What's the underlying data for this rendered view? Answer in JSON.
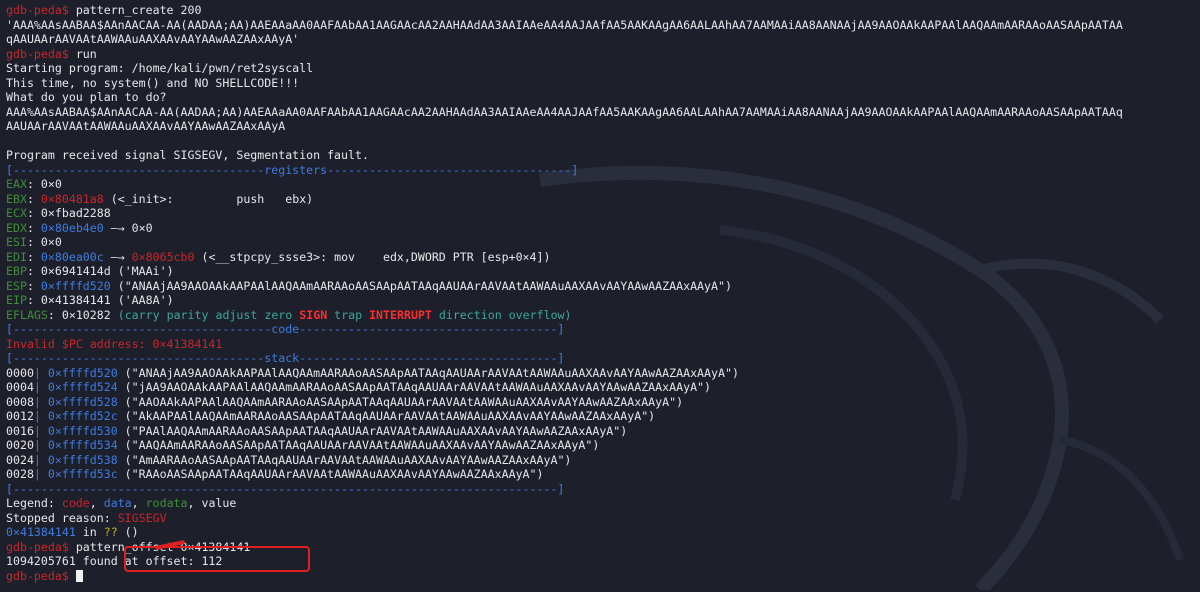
{
  "prompt": "gdb-peda$",
  "cmd_pattern_create": "pattern_create 200",
  "pattern_quoted_1": "'AAA%AAsAABAA$AAnAACAA-AA(AADAA;AA)AAEAAaAA0AAFAAbAA1AAGAAcAA2AAHAAdAA3AAIAAeAA4AAJAAfAA5AAKAAgAA6AALAAhAA7AAMAAiAA8AANAAjAA9AAOAAkAAPAAlAAQAAmAARAAoAASAApAATAA",
  "pattern_quoted_2": "qAAUAArAAVAAtAAWAAuAAXAAvAAYAAwAAZAAxAAyA'",
  "cmd_run": "run",
  "starting": "Starting program: /home/kali/pwn/ret2syscall",
  "msg1": "This time, no system() and NO SHELLCODE!!!",
  "msg2": "What do you plan to do?",
  "input_1": "AAA%AAsAABAA$AAnAACAA-AA(AADAA;AA)AAEAAaAA0AAFAAbAA1AAGAAcAA2AAHAAdAA3AAIAAeAA4AAJAAfAA5AAKAAgAA6AALAAhAA7AAMAAiAA8AANAAjAA9AAOAAkAAPAAlAAQAAmAARAAoAASAApAATAAq",
  "input_2": "AAUAArAAVAAtAAWAAuAAXAAvAAYAAwAAZAAxAAyA",
  "signal": "Program received signal SIGSEGV, Segmentation fault.",
  "divider_registers": "[------------------------------------registers-----------------------------------]",
  "divider_code": "[-------------------------------------code-------------------------------------]",
  "divider_stack": "[------------------------------------stack-------------------------------------]",
  "divider_end": "[------------------------------------------------------------------------------]",
  "registers": {
    "eax": {
      "name": "EAX",
      "value": "0×0",
      "rest": ""
    },
    "ebx": {
      "name": "EBX",
      "value": "0×80481a8",
      "rest": " (<_init>:         push   ebx)"
    },
    "ecx": {
      "name": "ECX",
      "value": "0×fbad2288",
      "rest": ""
    },
    "edx": {
      "name": "EDX",
      "value": "0×80eb4e0",
      "rest": " —→ 0×0"
    },
    "esi": {
      "name": "ESI",
      "value": "0×0",
      "rest": ""
    },
    "edi_name": "EDI",
    "edi_v1": "0×80ea00c",
    "edi_arrow": " —→ ",
    "edi_v2": "0×8065cb0",
    "edi_rest": " (<__stpcpy_ssse3>: mov    edx,DWORD PTR [esp+0×4])",
    "ebp": {
      "name": "EBP",
      "value": "0×6941414d",
      "rest": " ('MAAi')"
    },
    "esp": {
      "name": "ESP",
      "value": "0×ffffd520",
      "rest": " (\"ANAAjAA9AAOAAkAAPAAlAAQAAmAARAAoAASAApAATAAqAAUAArAAVAAtAAWAAuAAXAAvAAYAAwAAZAAxAAyA\")"
    },
    "eip": {
      "name": "EIP",
      "value": "0×41384141",
      "rest": " ('AA8A')"
    },
    "eflags_name": "EFLAGS",
    "eflags_value": "0×10282",
    "flags_open": "(",
    "flag_carry": "carry",
    "flag_parity": "parity",
    "flag_adjust": "adjust",
    "flag_zero": "zero",
    "flag_sign": "SIGN",
    "flag_trap": "trap",
    "flag_interrupt": "INTERRUPT",
    "flag_direction": "direction",
    "flag_overflow": "overflow",
    "flags_close": ")"
  },
  "invalid_pc": "Invalid $PC address: 0×41384141",
  "stack": [
    {
      "off": "0000",
      "addr": "0×ffffd520",
      "val": " (\"ANAAjAA9AAOAAkAAPAAlAAQAAmAARAAoAASAApAATAAqAAUAArAAVAAtAAWAAuAAXAAvAAYAAwAAZAAxAAyA\")"
    },
    {
      "off": "0004",
      "addr": "0×ffffd524",
      "val": " (\"jAA9AAOAAkAAPAAlAAQAAmAARAAoAASAApAATAAqAAUAArAAVAAtAAWAAuAAXAAvAAYAAwAAZAAxAAyA\")"
    },
    {
      "off": "0008",
      "addr": "0×ffffd528",
      "val": " (\"AAOAAkAAPAAlAAQAAmAARAAoAASAApAATAAqAAUAArAAVAAtAAWAAuAAXAAvAAYAAwAAZAAxAAyA\")"
    },
    {
      "off": "0012",
      "addr": "0×ffffd52c",
      "val": " (\"AkAAPAAlAAQAAmAARAAoAASAApAATAAqAAUAArAAVAAtAAWAAuAAXAAvAAYAAwAAZAAxAAyA\")"
    },
    {
      "off": "0016",
      "addr": "0×ffffd530",
      "val": " (\"PAAlAAQAAmAARAAoAASAApAATAAqAAUAArAAVAAtAAWAAuAAXAAvAAYAAwAAZAAxAAyA\")"
    },
    {
      "off": "0020",
      "addr": "0×ffffd534",
      "val": " (\"AAQAAmAARAAoAASAApAATAAqAAUAArAAVAAtAAWAAuAAXAAvAAYAAwAAZAAxAAyA\")"
    },
    {
      "off": "0024",
      "addr": "0×ffffd538",
      "val": " (\"AmAARAAoAASAApAATAAqAAUAArAAVAAtAAWAAuAAXAAvAAYAAwAAZAAxAAyA\")"
    },
    {
      "off": "0028",
      "addr": "0×ffffd53c",
      "val": " (\"RAAoAASAApAATAAqAAUAArAAVAAtAAWAAuAAXAAvAAYAAwAAZAAxAAyA\")"
    }
  ],
  "legend": {
    "prefix": "Legend: ",
    "code": "code",
    "sep1": ", ",
    "data": "data",
    "sep2": ", ",
    "rodata": "rodata",
    "sep3": ", ",
    "value": "value"
  },
  "stopped_prefix": "Stopped reason: ",
  "stopped_reason": "SIGSEGV",
  "frame_addr": "0×41384141",
  "frame_in": " in ",
  "frame_q": "??",
  "frame_paren": " ()",
  "cmd_offset": "pattern_offset 0×41384141",
  "offset_found": "1094205761 found at offset: 112",
  "colors": {
    "background": "#1d1f2b",
    "prompt": "#c9262a",
    "code": "#c9262a",
    "data": "#3d7de0",
    "rodata": "#3f8f3a",
    "highlight_box": "#e02020"
  }
}
